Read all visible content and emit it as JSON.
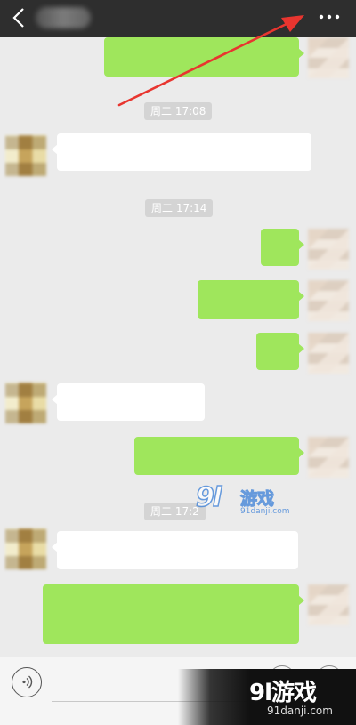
{
  "timestamps": [
    "周二 17:08",
    "周二 17:14",
    "周二 17:2"
  ],
  "input": {
    "placeholder": ""
  },
  "watermark": {
    "brand_num": "9l",
    "brand_cn": "游戏",
    "url": "91danji.com"
  },
  "logo": {
    "text": "9l游戏",
    "url": "91danji.com"
  },
  "icons": {
    "back": "chevron-left-icon",
    "more": "more-dots-icon",
    "voice": "voice-icon",
    "emoji": "emoji-icon",
    "plus": "plus-icon"
  },
  "colors": {
    "topbar": "#2e2e2e",
    "chat_bg": "#ebebeb",
    "sent_bubble": "#9fe65c",
    "received_bubble": "#ffffff",
    "timestamp_bg": "#d4d4d4",
    "annotation_arrow": "#e8352f"
  }
}
